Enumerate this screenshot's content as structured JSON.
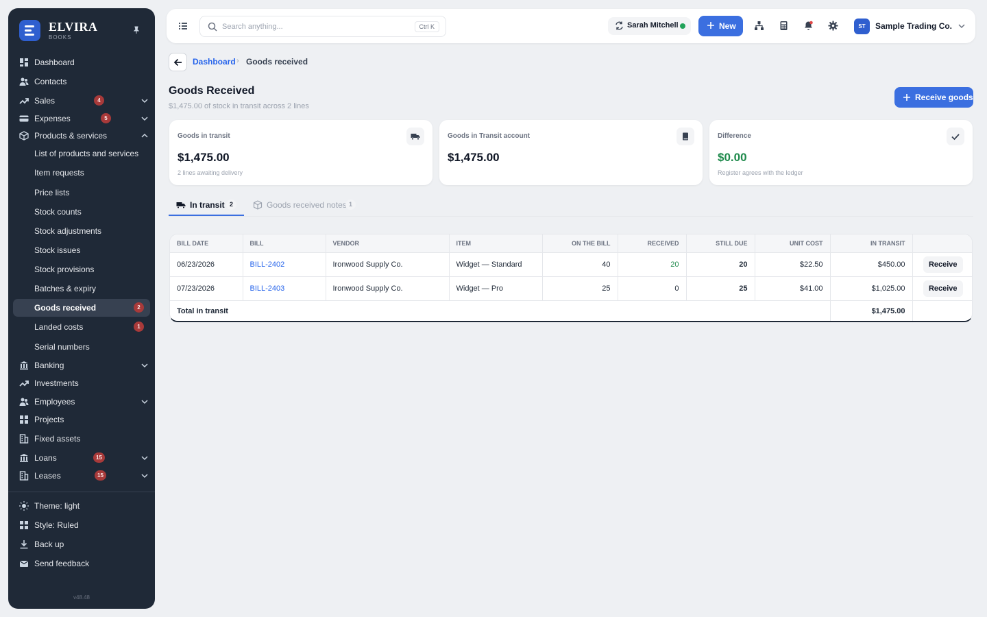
{
  "brand": {
    "name": "ELVIRA",
    "sub": "BOOKS"
  },
  "sidebar": {
    "items": [
      {
        "label": "Dashboard"
      },
      {
        "label": "Contacts"
      },
      {
        "label": "Sales",
        "badge": "4"
      },
      {
        "label": "Expenses",
        "badge": "5"
      },
      {
        "label": "Products & services"
      },
      {
        "label": "List of products and services"
      },
      {
        "label": "Item requests"
      },
      {
        "label": "Price lists"
      },
      {
        "label": "Stock counts"
      },
      {
        "label": "Stock adjustments"
      },
      {
        "label": "Stock issues"
      },
      {
        "label": "Stock provisions"
      },
      {
        "label": "Batches & expiry"
      },
      {
        "label": "Goods received",
        "badge": "2"
      },
      {
        "label": "Landed costs",
        "badge": "1"
      },
      {
        "label": "Serial numbers"
      },
      {
        "label": "Banking"
      },
      {
        "label": "Investments"
      },
      {
        "label": "Employees"
      },
      {
        "label": "Projects"
      },
      {
        "label": "Fixed assets"
      },
      {
        "label": "Loans",
        "badge": "15"
      },
      {
        "label": "Leases",
        "badge": "15"
      }
    ],
    "footer": [
      {
        "label": "Theme: light"
      },
      {
        "label": "Style: Ruled"
      },
      {
        "label": "Back up"
      },
      {
        "label": "Send feedback"
      }
    ],
    "version": "v48.48"
  },
  "topbar": {
    "search_placeholder": "Search anything...",
    "shortcut": "Ctrl K",
    "user": "Sarah Mitchell",
    "new_label": "New",
    "org_initials": "ST",
    "org_name": "Sample Trading Co."
  },
  "breadcrumb": {
    "parent": "Dashboard",
    "current": "Goods received"
  },
  "page": {
    "title": "Goods Received",
    "subtitle": "$1,475.00 of stock in transit across 2 lines",
    "action": "Receive goods"
  },
  "cards": [
    {
      "title": "Goods in transit",
      "value": "$1,475.00",
      "sub": "2 lines awaiting delivery"
    },
    {
      "title": "Goods in Transit account",
      "value": "$1,475.00",
      "sub": ""
    },
    {
      "title": "Difference",
      "value": "$0.00",
      "sub": "Register agrees with the ledger",
      "value_color": "#1f8a4c"
    }
  ],
  "tabs": [
    {
      "label": "In transit",
      "count": "2"
    },
    {
      "label": "Goods received notes",
      "count": "1"
    }
  ],
  "table": {
    "headers": [
      "BILL DATE",
      "BILL",
      "VENDOR",
      "ITEM",
      "ON THE BILL",
      "RECEIVED",
      "STILL DUE",
      "UNIT COST",
      "IN TRANSIT",
      ""
    ],
    "rows": [
      {
        "date": "06/23/2026",
        "bill": "BILL-2402",
        "vendor": "Ironwood Supply Co.",
        "item": "Widget — Standard",
        "on_bill": "40",
        "received": "20",
        "still_due": "20",
        "unit_cost": "$22.50",
        "in_transit": "$450.00",
        "action": "Receive"
      },
      {
        "date": "07/23/2026",
        "bill": "BILL-2403",
        "vendor": "Ironwood Supply Co.",
        "item": "Widget — Pro",
        "on_bill": "25",
        "received": "0",
        "still_due": "25",
        "unit_cost": "$41.00",
        "in_transit": "$1,025.00",
        "action": "Receive"
      }
    ],
    "total_label": "Total in transit",
    "total_value": "$1,475.00"
  }
}
